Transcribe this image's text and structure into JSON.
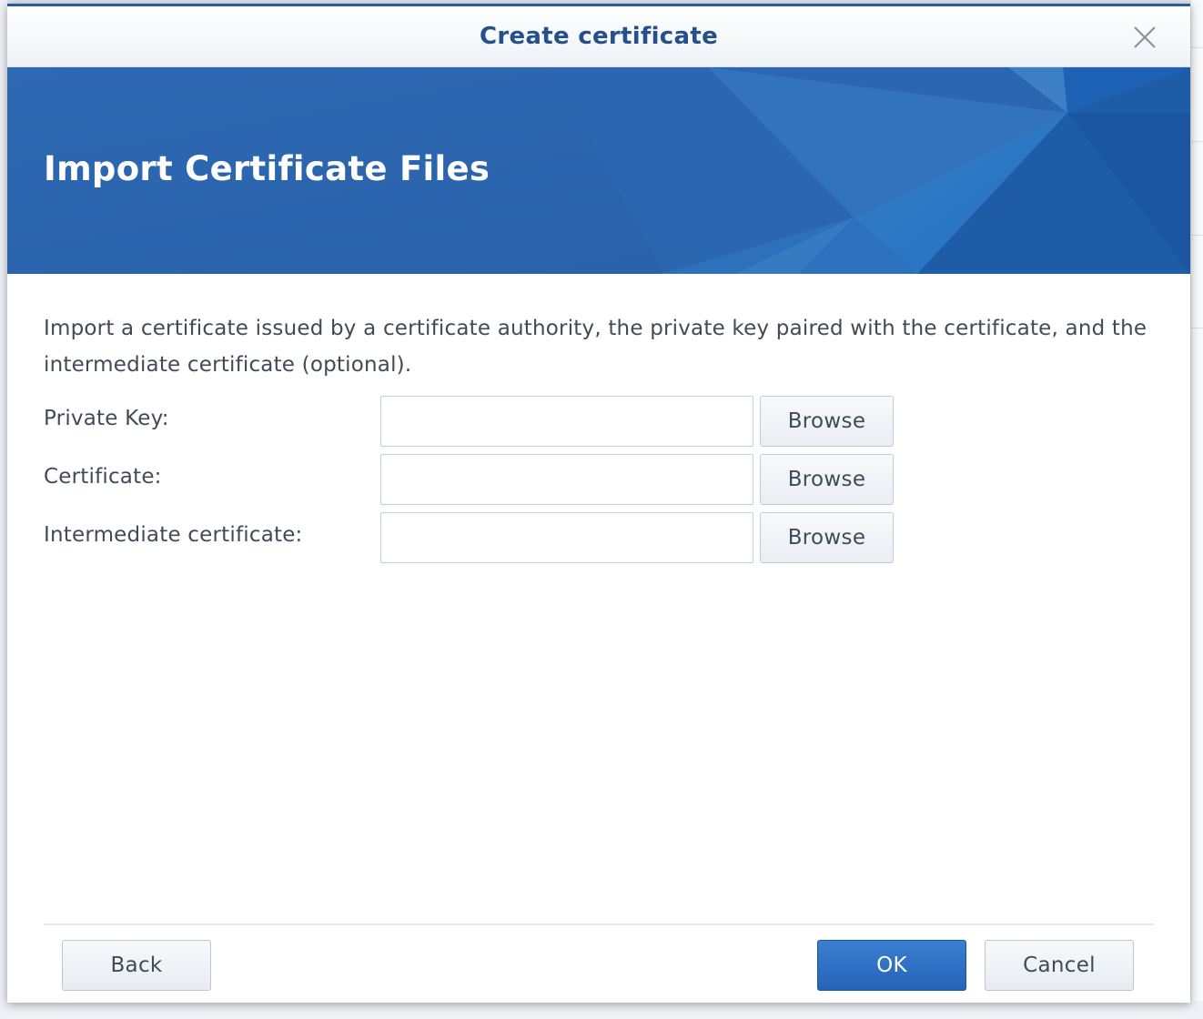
{
  "dialog": {
    "title": "Create certificate",
    "banner_title": "Import Certificate Files",
    "description": "Import a certificate issued by a certificate authority, the private key paired with the certificate, and the intermediate certificate (optional).",
    "fields": [
      {
        "label": "Private Key:",
        "value": "",
        "browse_label": "Browse"
      },
      {
        "label": "Certificate:",
        "value": "",
        "browse_label": "Browse"
      },
      {
        "label": "Intermediate certificate:",
        "value": "",
        "browse_label": "Browse"
      }
    ],
    "buttons": {
      "back": "Back",
      "ok": "OK",
      "cancel": "Cancel"
    },
    "close_icon": "close-icon"
  },
  "colors": {
    "title_text": "#255089",
    "banner_blue": "#2c66b0",
    "primary_button": "#2563b7"
  }
}
